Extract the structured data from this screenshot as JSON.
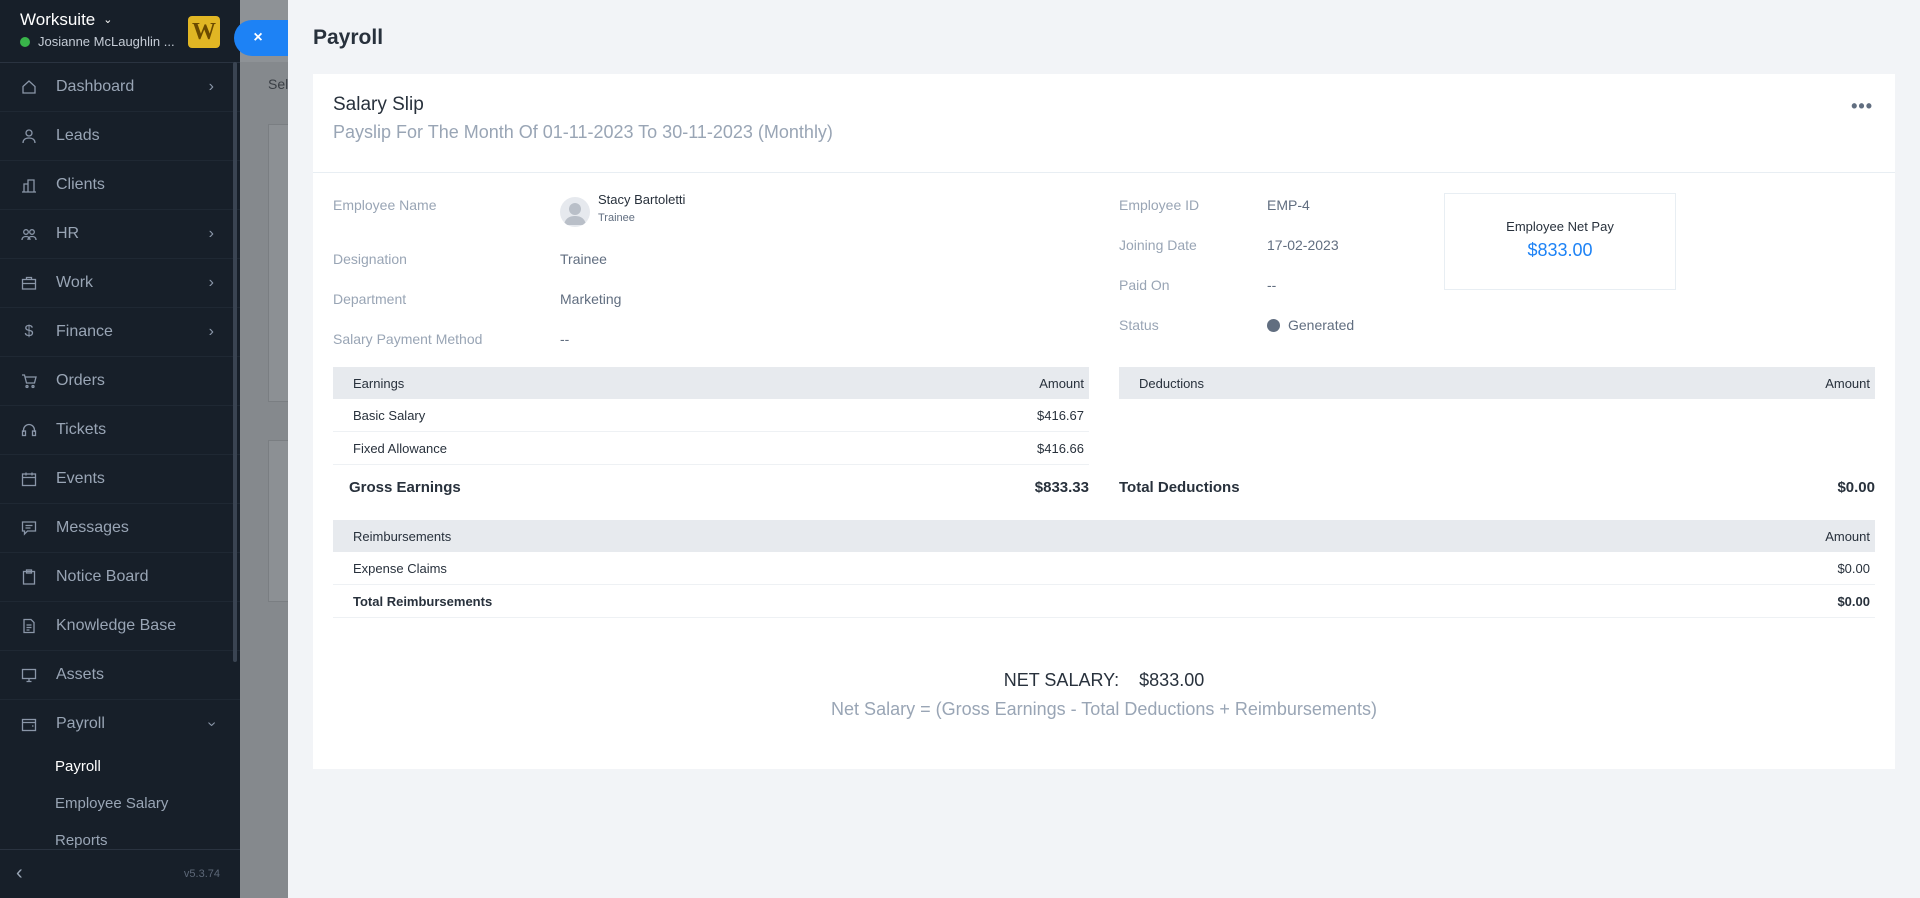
{
  "sidebar": {
    "brand": "Worksuite",
    "user": "Josianne McLaughlin ...",
    "logo_letter": "W",
    "items": [
      {
        "label": "Dashboard",
        "icon": "home-icon",
        "arrow": true
      },
      {
        "label": "Leads",
        "icon": "user-icon",
        "arrow": false
      },
      {
        "label": "Clients",
        "icon": "building-icon",
        "arrow": false
      },
      {
        "label": "HR",
        "icon": "people-icon",
        "arrow": true
      },
      {
        "label": "Work",
        "icon": "briefcase-icon",
        "arrow": true
      },
      {
        "label": "Finance",
        "icon": "dollar-icon",
        "arrow": true
      },
      {
        "label": "Orders",
        "icon": "cart-icon",
        "arrow": false
      },
      {
        "label": "Tickets",
        "icon": "headset-icon",
        "arrow": false
      },
      {
        "label": "Events",
        "icon": "calendar-icon",
        "arrow": false
      },
      {
        "label": "Messages",
        "icon": "chat-icon",
        "arrow": false
      },
      {
        "label": "Notice Board",
        "icon": "clipboard-icon",
        "arrow": false
      },
      {
        "label": "Knowledge Base",
        "icon": "document-icon",
        "arrow": false
      },
      {
        "label": "Assets",
        "icon": "monitor-icon",
        "arrow": false
      },
      {
        "label": "Payroll",
        "icon": "wallet-icon",
        "arrow": true
      }
    ],
    "payroll_sub": [
      "Payroll",
      "Employee Salary",
      "Reports"
    ],
    "version": "v5.3.74"
  },
  "background": {
    "select_label": "Sel"
  },
  "close_button": "×",
  "panel": {
    "title": "Payroll"
  },
  "slip": {
    "title": "Salary Slip",
    "subtitle": "Payslip For The Month Of 01-11-2023 To 30-11-2023 (Monthly)",
    "more": "•••"
  },
  "employee": {
    "name_label": "Employee Name",
    "name": "Stacy Bartoletti",
    "role": "Trainee",
    "designation_label": "Designation",
    "designation": "Trainee",
    "department_label": "Department",
    "department": "Marketing",
    "payment_method_label": "Salary Payment Method",
    "payment_method": "--",
    "id_label": "Employee ID",
    "id": "EMP-4",
    "joining_label": "Joining Date",
    "joining": "17-02-2023",
    "paid_on_label": "Paid On",
    "paid_on": "--",
    "status_label": "Status",
    "status": "Generated",
    "status_color": "#616e80"
  },
  "net_pay_box": {
    "label": "Employee Net Pay",
    "value": "$833.00"
  },
  "earnings": {
    "header": "Earnings",
    "amount_header": "Amount",
    "rows": [
      {
        "name": "Basic Salary",
        "amount": "$416.67"
      },
      {
        "name": "Fixed Allowance",
        "amount": "$416.66"
      }
    ],
    "total_label": "Gross Earnings",
    "total": "$833.33"
  },
  "deductions": {
    "header": "Deductions",
    "amount_header": "Amount",
    "total_label": "Total Deductions",
    "total": "$0.00"
  },
  "reimbursements": {
    "header": "Reimbursements",
    "amount_header": "Amount",
    "rows": [
      {
        "name": "Expense Claims",
        "amount": "$0.00"
      }
    ],
    "total_label": "Total Reimbursements",
    "total": "$0.00"
  },
  "net_salary": {
    "label": "NET SALARY:",
    "value": "$833.00",
    "formula": "Net Salary = (Gross Earnings - Total Deductions + Reimbursements)"
  }
}
